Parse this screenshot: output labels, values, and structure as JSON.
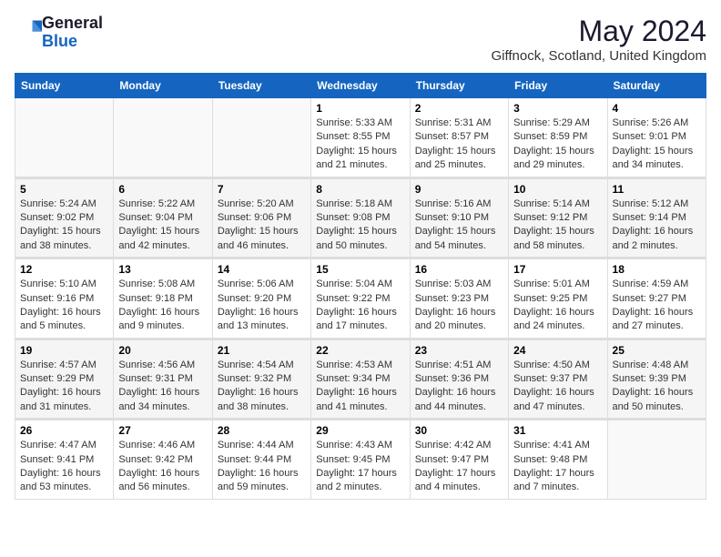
{
  "header": {
    "logo_line1": "General",
    "logo_line2": "Blue",
    "title": "May 2024",
    "subtitle": "Giffnock, Scotland, United Kingdom"
  },
  "columns": [
    "Sunday",
    "Monday",
    "Tuesday",
    "Wednesday",
    "Thursday",
    "Friday",
    "Saturday"
  ],
  "weeks": [
    {
      "days": [
        {
          "num": "",
          "text": ""
        },
        {
          "num": "",
          "text": ""
        },
        {
          "num": "",
          "text": ""
        },
        {
          "num": "1",
          "text": "Sunrise: 5:33 AM\nSunset: 8:55 PM\nDaylight: 15 hours\nand 21 minutes."
        },
        {
          "num": "2",
          "text": "Sunrise: 5:31 AM\nSunset: 8:57 PM\nDaylight: 15 hours\nand 25 minutes."
        },
        {
          "num": "3",
          "text": "Sunrise: 5:29 AM\nSunset: 8:59 PM\nDaylight: 15 hours\nand 29 minutes."
        },
        {
          "num": "4",
          "text": "Sunrise: 5:26 AM\nSunset: 9:01 PM\nDaylight: 15 hours\nand 34 minutes."
        }
      ]
    },
    {
      "days": [
        {
          "num": "5",
          "text": "Sunrise: 5:24 AM\nSunset: 9:02 PM\nDaylight: 15 hours\nand 38 minutes."
        },
        {
          "num": "6",
          "text": "Sunrise: 5:22 AM\nSunset: 9:04 PM\nDaylight: 15 hours\nand 42 minutes."
        },
        {
          "num": "7",
          "text": "Sunrise: 5:20 AM\nSunset: 9:06 PM\nDaylight: 15 hours\nand 46 minutes."
        },
        {
          "num": "8",
          "text": "Sunrise: 5:18 AM\nSunset: 9:08 PM\nDaylight: 15 hours\nand 50 minutes."
        },
        {
          "num": "9",
          "text": "Sunrise: 5:16 AM\nSunset: 9:10 PM\nDaylight: 15 hours\nand 54 minutes."
        },
        {
          "num": "10",
          "text": "Sunrise: 5:14 AM\nSunset: 9:12 PM\nDaylight: 15 hours\nand 58 minutes."
        },
        {
          "num": "11",
          "text": "Sunrise: 5:12 AM\nSunset: 9:14 PM\nDaylight: 16 hours\nand 2 minutes."
        }
      ]
    },
    {
      "days": [
        {
          "num": "12",
          "text": "Sunrise: 5:10 AM\nSunset: 9:16 PM\nDaylight: 16 hours\nand 5 minutes."
        },
        {
          "num": "13",
          "text": "Sunrise: 5:08 AM\nSunset: 9:18 PM\nDaylight: 16 hours\nand 9 minutes."
        },
        {
          "num": "14",
          "text": "Sunrise: 5:06 AM\nSunset: 9:20 PM\nDaylight: 16 hours\nand 13 minutes."
        },
        {
          "num": "15",
          "text": "Sunrise: 5:04 AM\nSunset: 9:22 PM\nDaylight: 16 hours\nand 17 minutes."
        },
        {
          "num": "16",
          "text": "Sunrise: 5:03 AM\nSunset: 9:23 PM\nDaylight: 16 hours\nand 20 minutes."
        },
        {
          "num": "17",
          "text": "Sunrise: 5:01 AM\nSunset: 9:25 PM\nDaylight: 16 hours\nand 24 minutes."
        },
        {
          "num": "18",
          "text": "Sunrise: 4:59 AM\nSunset: 9:27 PM\nDaylight: 16 hours\nand 27 minutes."
        }
      ]
    },
    {
      "days": [
        {
          "num": "19",
          "text": "Sunrise: 4:57 AM\nSunset: 9:29 PM\nDaylight: 16 hours\nand 31 minutes."
        },
        {
          "num": "20",
          "text": "Sunrise: 4:56 AM\nSunset: 9:31 PM\nDaylight: 16 hours\nand 34 minutes."
        },
        {
          "num": "21",
          "text": "Sunrise: 4:54 AM\nSunset: 9:32 PM\nDaylight: 16 hours\nand 38 minutes."
        },
        {
          "num": "22",
          "text": "Sunrise: 4:53 AM\nSunset: 9:34 PM\nDaylight: 16 hours\nand 41 minutes."
        },
        {
          "num": "23",
          "text": "Sunrise: 4:51 AM\nSunset: 9:36 PM\nDaylight: 16 hours\nand 44 minutes."
        },
        {
          "num": "24",
          "text": "Sunrise: 4:50 AM\nSunset: 9:37 PM\nDaylight: 16 hours\nand 47 minutes."
        },
        {
          "num": "25",
          "text": "Sunrise: 4:48 AM\nSunset: 9:39 PM\nDaylight: 16 hours\nand 50 minutes."
        }
      ]
    },
    {
      "days": [
        {
          "num": "26",
          "text": "Sunrise: 4:47 AM\nSunset: 9:41 PM\nDaylight: 16 hours\nand 53 minutes."
        },
        {
          "num": "27",
          "text": "Sunrise: 4:46 AM\nSunset: 9:42 PM\nDaylight: 16 hours\nand 56 minutes."
        },
        {
          "num": "28",
          "text": "Sunrise: 4:44 AM\nSunset: 9:44 PM\nDaylight: 16 hours\nand 59 minutes."
        },
        {
          "num": "29",
          "text": "Sunrise: 4:43 AM\nSunset: 9:45 PM\nDaylight: 17 hours\nand 2 minutes."
        },
        {
          "num": "30",
          "text": "Sunrise: 4:42 AM\nSunset: 9:47 PM\nDaylight: 17 hours\nand 4 minutes."
        },
        {
          "num": "31",
          "text": "Sunrise: 4:41 AM\nSunset: 9:48 PM\nDaylight: 17 hours\nand 7 minutes."
        },
        {
          "num": "",
          "text": ""
        }
      ]
    }
  ]
}
